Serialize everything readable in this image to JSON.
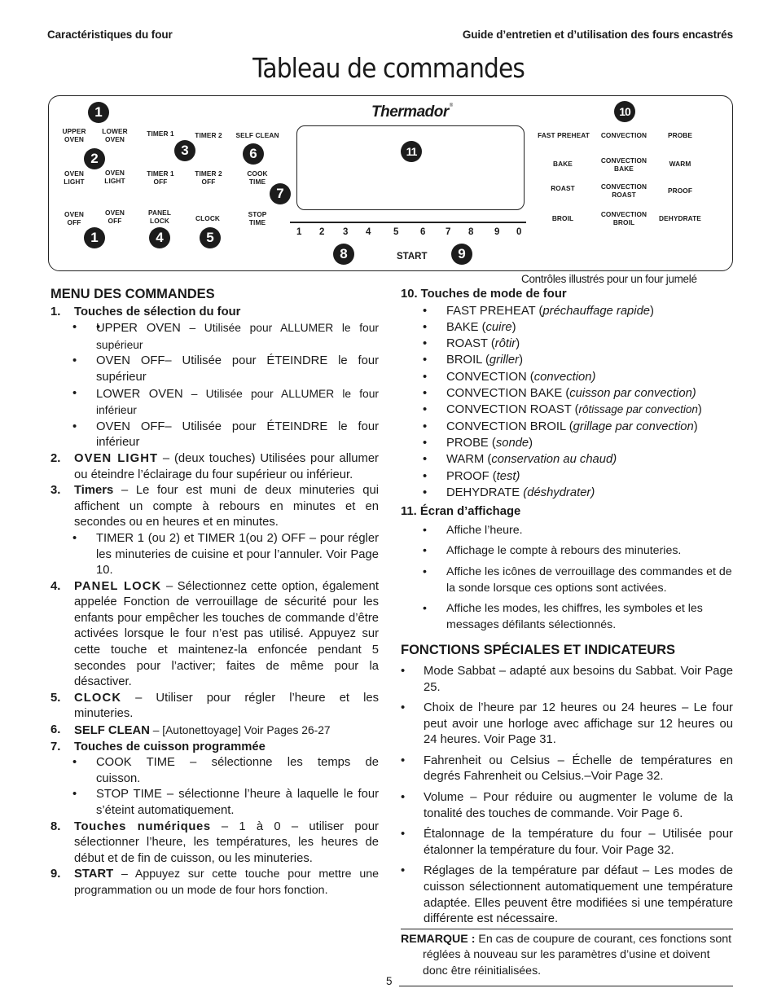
{
  "header": {
    "left": "Caractéristiques du four",
    "right": "Guide d’entretien et d’utilisation des fours encastrés"
  },
  "title": "Tableau de commandes",
  "panel": {
    "brand": "Thermador",
    "brand_mark": "®",
    "keys": {
      "upper_oven": "UPPER\nOVEN",
      "lower_oven": "LOWER\nOVEN",
      "oven_light_1": "OVEN\nLIGHT",
      "oven_light_2": "OVEN\nLIGHT",
      "oven_off_1": "OVEN\nOFF",
      "oven_off_2": "OVEN\nOFF",
      "timer1": "TIMER 1",
      "timer2": "TIMER 2",
      "timer1_off": "TIMER 1\nOFF",
      "timer2_off": "TIMER 2\nOFF",
      "panel_lock": "PANEL\nLOCK",
      "clock": "CLOCK",
      "self_clean": "SELF CLEAN",
      "cook_time": "COOK\nTIME",
      "stop_time": "STOP\nTIME",
      "fast_preheat": "FAST PREHEAT",
      "convection": "CONVECTION",
      "probe": "PROBE",
      "bake": "BAKE",
      "convection_bake": "CONVECTION\nBAKE",
      "warm": "WARM",
      "roast": "ROAST",
      "convection_roast": "CONVECTION\nROAST",
      "proof": "PROOF",
      "broil": "BROIL",
      "convection_broil": "CONVECTION\nBROIL",
      "dehydrate": "DEHYDRATE",
      "start": "START"
    },
    "numbers": [
      "1",
      "2",
      "3",
      "4",
      "5",
      "6",
      "7",
      "8",
      "9",
      "0"
    ],
    "badges": {
      "b1_top": "1",
      "b2": "2",
      "b1_bottom": "1",
      "b3": "3",
      "b4": "4",
      "b5": "5",
      "b6": "6",
      "b7": "7",
      "b8": "8",
      "b9": "9",
      "b10": "10",
      "b11": "11"
    },
    "caption": "Contrôles illustrés pour un four jumelé"
  },
  "left": {
    "heading": "MENU DES COMMANDES",
    "s1": {
      "num": "1.",
      "title": "Touches de sélection du four",
      "bullets": [
        {
          "key": "UPPER OVEN",
          "text": " – Utilisée pour ALLUMER le four supérieur"
        },
        {
          "key": "OVEN OFF",
          "text": "– Utilisée pour ÉTEINDRE le four supérieur"
        },
        {
          "key": "LOWER OVEN",
          "text": " – Utilisée pour ALLUMER le four inférieur"
        },
        {
          "key": "OVEN OFF",
          "text": "– Utilisée pour ÉTEINDRE le four inférieur"
        }
      ]
    },
    "s2": {
      "num": "2.",
      "title": "OVEN LIGHT",
      "text": " – (deux touches) Utilisées pour allumer ou éteindre l’éclairage du four supérieur ou inférieur."
    },
    "s3": {
      "num": "3.",
      "title": "Timers",
      "text": " – Le four est muni de deux minuteries qui affichent un compte à rebours en minutes et en secondes ou en heures et en minutes.",
      "bullets": [
        "TIMER 1 (ou 2) et TIMER 1(ou 2) OFF – pour régler les minuteries de cuisine et pour l’annuler. Voir Page 10."
      ]
    },
    "s4": {
      "num": "4.",
      "title": "PANEL LOCK",
      "text": " – Sélectionnez cette option, également appelée Fonction de verrouillage de sécurité pour les enfants pour empêcher les touches de commande d’être activées lorsque le four n’est pas utilisé. Appuyez sur cette touche et maintenez-la enfoncée pendant 5 secondes pour l’activer; faites de même pour la désactiver."
    },
    "s5": {
      "num": "5.",
      "title": "CLOCK",
      "text": " – Utiliser pour régler l’heure et les minuteries."
    },
    "s6": {
      "num": "6.",
      "title": "SELF CLEAN",
      "text": " – [Autonettoyage] Voir Pages 26-27"
    },
    "s7": {
      "num": "7.",
      "title": "Touches de cuisson programmée",
      "bullets": [
        "COOK TIME – sélectionne les temps de cuisson.",
        "STOP TIME – sélectionne l’heure à laquelle le four s’éteint automatiquement."
      ]
    },
    "s8": {
      "num": "8.",
      "title": "Touches numériques",
      "text": " – 1 à 0 – utiliser pour sélectionner l’heure, les températures, les heures de début et de fin de cuisson, ou les minuteries."
    },
    "s9": {
      "num": "9.",
      "title": "START",
      "text": " – Appuyez sur cette touche pour mettre une programmation ou un mode de four hors fonction."
    }
  },
  "right": {
    "s10": {
      "title": "10. Touches de mode de four",
      "modes": [
        {
          "key": "FAST PREHEAT (",
          "fr": "préchauffage rapide",
          "end": ")"
        },
        {
          "key": "BAKE (",
          "fr": "cuire",
          "end": ")"
        },
        {
          "key": "ROAST (",
          "fr": "rôtir",
          "end": ")"
        },
        {
          "key": "BROIL (",
          "fr": "griller",
          "end": ")"
        },
        {
          "key": "CONVECTION (",
          "fr": "convection)",
          "end": ""
        },
        {
          "key": "CONVECTION BAKE (",
          "fr": "cuisson par convection)",
          "end": ""
        },
        {
          "key": "CONVECTION ROAST (",
          "fr": "rôtissage par convection",
          "end": ")"
        },
        {
          "key": "CONVECTION BROIL (",
          "fr": "grillage par convection",
          "end": ")"
        },
        {
          "key": "PROBE  (",
          "fr": "sonde",
          "end": ")"
        },
        {
          "key": "WARM (",
          "fr": "conservation au chaud)",
          "end": ""
        },
        {
          "key": "PROOF (",
          "fr": "test)",
          "end": ""
        },
        {
          "key": "DEHYDRATE  ",
          "fr": "(déshydrater)",
          "end": ""
        }
      ]
    },
    "s11": {
      "title": "11. Écran d’affichage",
      "bullets": [
        "Affiche l’heure.",
        "Affichage le compte à rebours des minuteries.",
        "Affiche les icônes de verrouillage des commandes et de la sonde lorsque ces options sont activées.",
        "Affiche les modes, les chiffres, les symboles et les messages défilants sélectionnés."
      ]
    },
    "special": {
      "heading": "FONCTIONS SPÉCIALES ET INDICATEURS",
      "bullets": [
        "Mode Sabbat – adapté aux besoins du Sabbat. Voir Page 25.",
        "Choix de l’heure par 12 heures ou 24 heures – Le four peut avoir une horloge avec affichage sur 12 heures ou 24 heures. Voir Page 31.",
        "Fahrenheit ou Celsius – Échelle de températures en degrés Fahrenheit ou Celsius.–Voir Page 32.",
        "Volume – Pour réduire ou augmenter le volume de la tonalité des touches de commande. Voir Page 6.",
        "Étalonnage de la température du four – Utilisée pour étalonner la température du four. Voir Page 32.",
        "Réglages de la température par défaut – Les modes de cuisson sélectionnent automatiquement une température adaptée. Elles peuvent être modifiées si une température différente est nécessaire."
      ]
    },
    "note": {
      "label": "REMARQUE :",
      "text": " En cas de coupure de courant, ces fonctions sont réglées à nouveau sur les paramètres d’usine et doivent donc être réinitialisées."
    }
  },
  "page_number": "5"
}
